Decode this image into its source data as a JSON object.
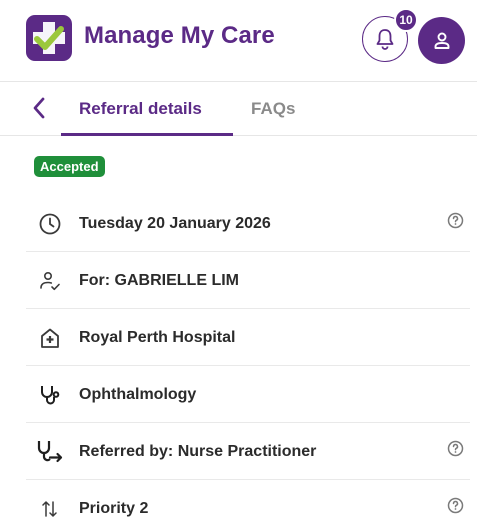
{
  "header": {
    "app_title": "Manage My Care",
    "notification_count": "10",
    "logo_icon": "care-logo-icon",
    "notification_icon": "bell-icon",
    "profile_icon": "user-icon"
  },
  "tabs": {
    "back_icon": "chevron-left-icon",
    "items": [
      {
        "label": "Referral details",
        "active": true
      },
      {
        "label": "FAQs",
        "active": false
      }
    ]
  },
  "referral": {
    "status": "Accepted",
    "details": [
      {
        "icon": "clock-icon",
        "text": "Tuesday 20 January 2026",
        "help": true
      },
      {
        "icon": "person-check-icon",
        "text": "For: GABRIELLE LIM",
        "help": false
      },
      {
        "icon": "hospital-icon",
        "text": "Royal Perth Hospital",
        "help": false
      },
      {
        "icon": "stethoscope-icon",
        "text": "Ophthalmology",
        "help": false
      },
      {
        "icon": "stethoscope-referral-icon",
        "text": "Referred by: Nurse Practitioner",
        "help": true
      },
      {
        "icon": "priority-arrows-icon",
        "text": "Priority 2",
        "help": true
      }
    ]
  },
  "colors": {
    "brand": "#5b2a86",
    "status_accepted": "#1f8f3a",
    "logo_check": "#9bc83c"
  }
}
